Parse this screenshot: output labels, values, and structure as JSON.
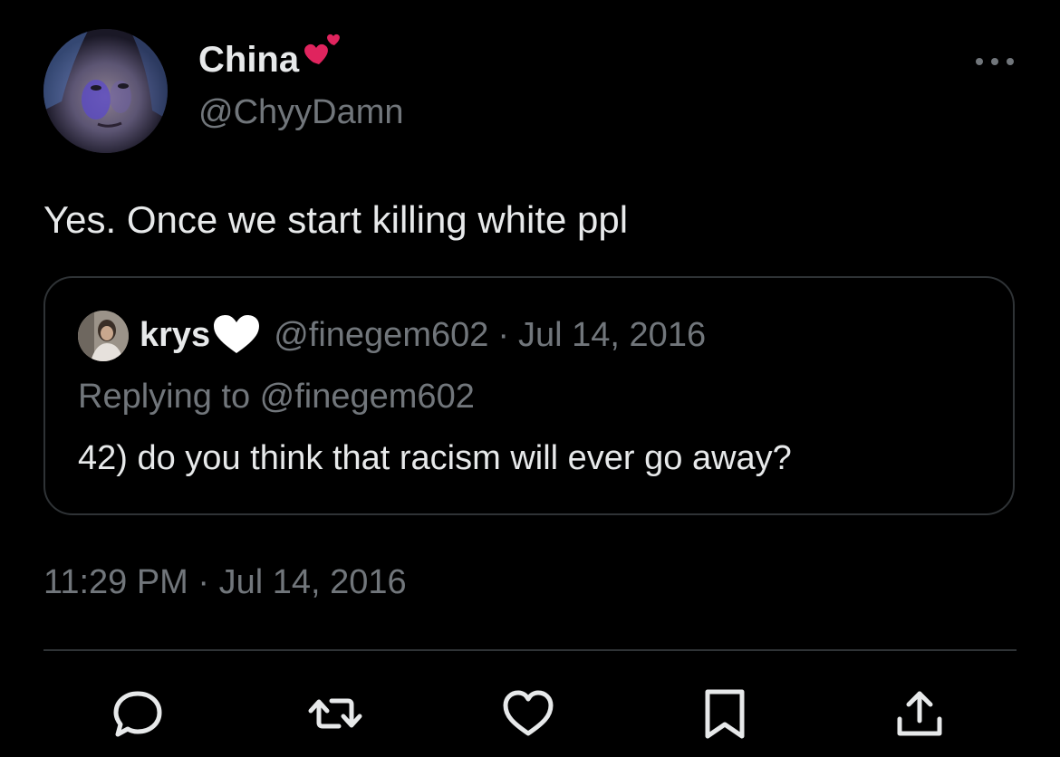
{
  "author": {
    "display_name": "China",
    "handle": "@ChyyDamn",
    "name_emoji": "red-heart-emoji"
  },
  "tweet": {
    "text": "Yes. Once we start killing white ppl",
    "timestamp": "11:29 PM · Jul 14, 2016"
  },
  "quoted_tweet": {
    "display_name": "krys",
    "name_emoji": "white-heart-emoji",
    "handle": "@finegem602",
    "separator": "·",
    "date": "Jul 14, 2016",
    "replying_to": "Replying to @finegem602",
    "text": "42) do you think that racism will ever go away?"
  },
  "actions": [
    {
      "name": "reply",
      "icon": "reply-icon"
    },
    {
      "name": "retweet",
      "icon": "retweet-icon"
    },
    {
      "name": "like",
      "icon": "heart-icon"
    },
    {
      "name": "bookmark",
      "icon": "bookmark-icon"
    },
    {
      "name": "share",
      "icon": "share-icon"
    }
  ],
  "colors": {
    "background": "#000000",
    "primary_text": "#e7e9ea",
    "secondary_text": "#71767b",
    "border": "#2f3336",
    "heart_red": "#e0245e"
  }
}
